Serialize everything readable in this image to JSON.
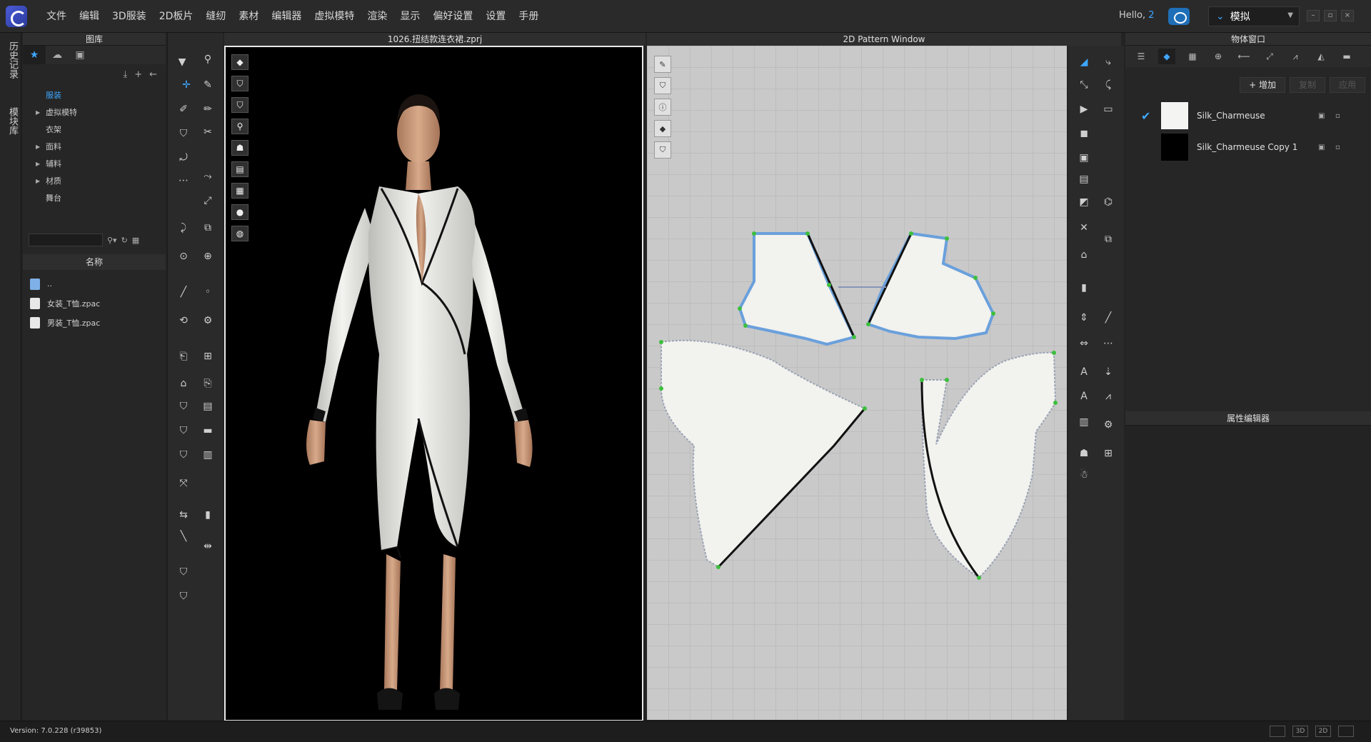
{
  "app": {
    "menus": [
      "文件",
      "编辑",
      "3D服装",
      "2D板片",
      "缝纫",
      "素材",
      "编辑器",
      "虚拟模特",
      "渲染",
      "显示",
      "偏好设置",
      "设置",
      "手册"
    ],
    "hello_text": "Hello,",
    "user_count": "2",
    "mode_label": "模拟"
  },
  "left_strip": {
    "tabs": [
      "历史记录",
      "模块库"
    ]
  },
  "library": {
    "title": "图库",
    "tree": [
      {
        "label": "服装",
        "expandable": false,
        "active": true
      },
      {
        "label": "虚拟模特",
        "expandable": true,
        "active": false
      },
      {
        "label": "衣架",
        "expandable": false,
        "active": false
      },
      {
        "label": "面料",
        "expandable": true,
        "active": false
      },
      {
        "label": "辅料",
        "expandable": true,
        "active": false
      },
      {
        "label": "材质",
        "expandable": true,
        "active": false
      },
      {
        "label": "舞台",
        "expandable": false,
        "active": false
      }
    ],
    "search_placeholder": "",
    "name_header": "名称",
    "files": [
      "..",
      "女装_T恤.zpac",
      "男装_T恤.zpac"
    ]
  },
  "view3d": {
    "title": "1026.扭结款连衣裙.zprj"
  },
  "view2d": {
    "title": "2D Pattern Window"
  },
  "object_window": {
    "title": "物体窗口",
    "add_label": "+ 增加",
    "copy_label": "复制",
    "apply_label": "应用",
    "fabrics": [
      {
        "name": "Silk_Charmeuse",
        "swatch": "#f4f4f2",
        "checked": true
      },
      {
        "name": "Silk_Charmeuse Copy 1",
        "swatch": "#000000",
        "checked": false
      }
    ]
  },
  "property_editor": {
    "title": "属性编辑器"
  },
  "status": {
    "version": "Version: 7.0.228 (r39853)",
    "view_buttons": [
      "",
      "3D",
      "2D"
    ]
  },
  "colors": {
    "accent": "#3ea7ff",
    "pattern_outline": "#6aa0dc",
    "grid_bg": "#c9c9c9"
  }
}
